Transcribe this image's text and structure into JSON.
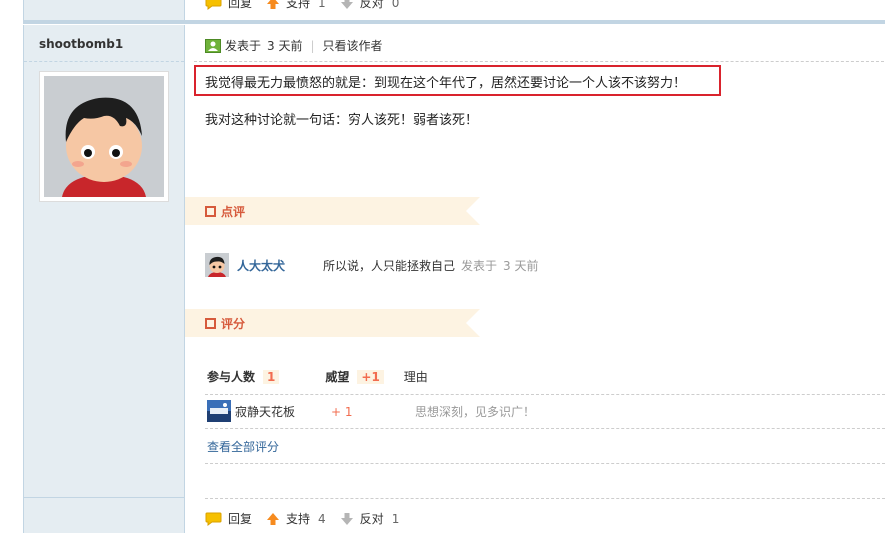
{
  "top_actions": {
    "reply_label": "回复",
    "support_label": "支持",
    "support_count": "1",
    "oppose_label": "反对",
    "oppose_count": "0"
  },
  "post": {
    "author": "shootbomb1",
    "posted_label": "发表于",
    "posted_time": "3 天前",
    "only_author_label": "只看该作者",
    "line1": "我觉得最无力最愤怒的就是：到现在这个年代了，居然还要讨论一个人该不该努力！",
    "line2": "我对这种讨论就一句话：穷人该死！弱者该死！"
  },
  "comments_section": {
    "title": "点评",
    "items": [
      {
        "user": "人大太犬",
        "text": "所以说，人只能拯救自己",
        "posted_label": "发表于",
        "time": "3 天前"
      }
    ]
  },
  "rating_section": {
    "title": "评分",
    "participants_label": "参与人数",
    "participants_count": "1",
    "prestige_label": "威望",
    "prestige_total": "+1",
    "reason_label": "理由",
    "rows": [
      {
        "user": "寂静天花板",
        "value": "+ 1",
        "reason": "思想深刻，见多识广！"
      }
    ],
    "view_all_label": "查看全部评分"
  },
  "bottom_actions": {
    "reply_label": "回复",
    "support_label": "支持",
    "support_count": "4",
    "oppose_label": "反对",
    "oppose_count": "1"
  },
  "colors": {
    "accent": "#d65a3c",
    "highlight_border": "#d9232d",
    "link": "#336699",
    "sidebar_bg": "#e5edf2",
    "tab_bg": "#fdf3e2"
  }
}
